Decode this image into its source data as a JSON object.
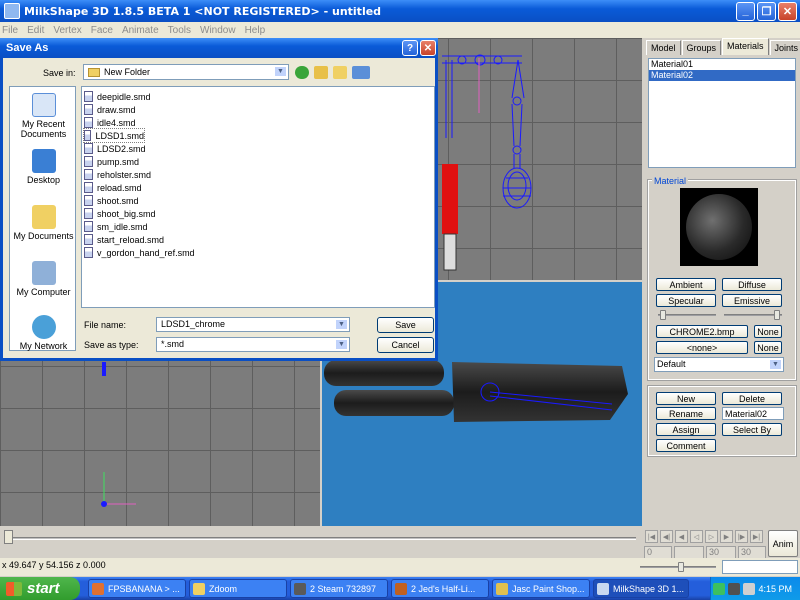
{
  "window": {
    "title": "MilkShape 3D 1.8.5 BETA 1 <NOT REGISTERED> - untitled"
  },
  "menu": [
    "File",
    "Edit",
    "Vertex",
    "Face",
    "Animate",
    "Tools",
    "Window",
    "Help"
  ],
  "tabs": [
    "Model",
    "Groups",
    "Materials",
    "Joints"
  ],
  "active_tab": "Materials",
  "materials": {
    "list": [
      "Material01",
      "Material02"
    ],
    "selected": "Material02",
    "group_label": "Material",
    "ambient": "Ambient",
    "diffuse": "Diffuse",
    "specular": "Specular",
    "emissive": "Emissive",
    "texture1": "CHROME2.bmp",
    "texture2": "<none>",
    "none1": "None",
    "none2": "None",
    "mode": "Default",
    "new": "New",
    "delete": "Delete",
    "rename": "Rename",
    "name_value": "Material02",
    "assign": "Assign",
    "select_by": "Select By",
    "comment": "Comment"
  },
  "timeline": {
    "frame1": "0",
    "frame2": "30",
    "frame3": "30",
    "anim": "Anim"
  },
  "status": {
    "coords": "x 49.647 y 54.156 z 0.000"
  },
  "dialog": {
    "title": "Save As",
    "save_in_label": "Save in:",
    "save_in_value": "New Folder",
    "places": [
      "My Recent Documents",
      "Desktop",
      "My Documents",
      "My Computer",
      "My Network"
    ],
    "files": [
      "deepidle.smd",
      "draw.smd",
      "idle4.smd",
      "LDSD1.smd",
      "LDSD2.smd",
      "pump.smd",
      "reholster.smd",
      "reload.smd",
      "shoot.smd",
      "shoot_big.smd",
      "sm_idle.smd",
      "start_reload.smd",
      "v_gordon_hand_ref.smd"
    ],
    "file_name_label": "File name:",
    "file_name_value": "LDSD1_chrome",
    "save_type_label": "Save as type:",
    "save_type_value": "*.smd",
    "save": "Save",
    "cancel": "Cancel"
  },
  "taskbar": {
    "start": "start",
    "items": [
      "FPSBANANA > ...",
      "Zdoom",
      "2 Steam 732897",
      "2 Jed's Half-Li...",
      "Jasc Paint Shop...",
      "MilkShape 3D 1..."
    ],
    "clock": "4:15 PM"
  }
}
